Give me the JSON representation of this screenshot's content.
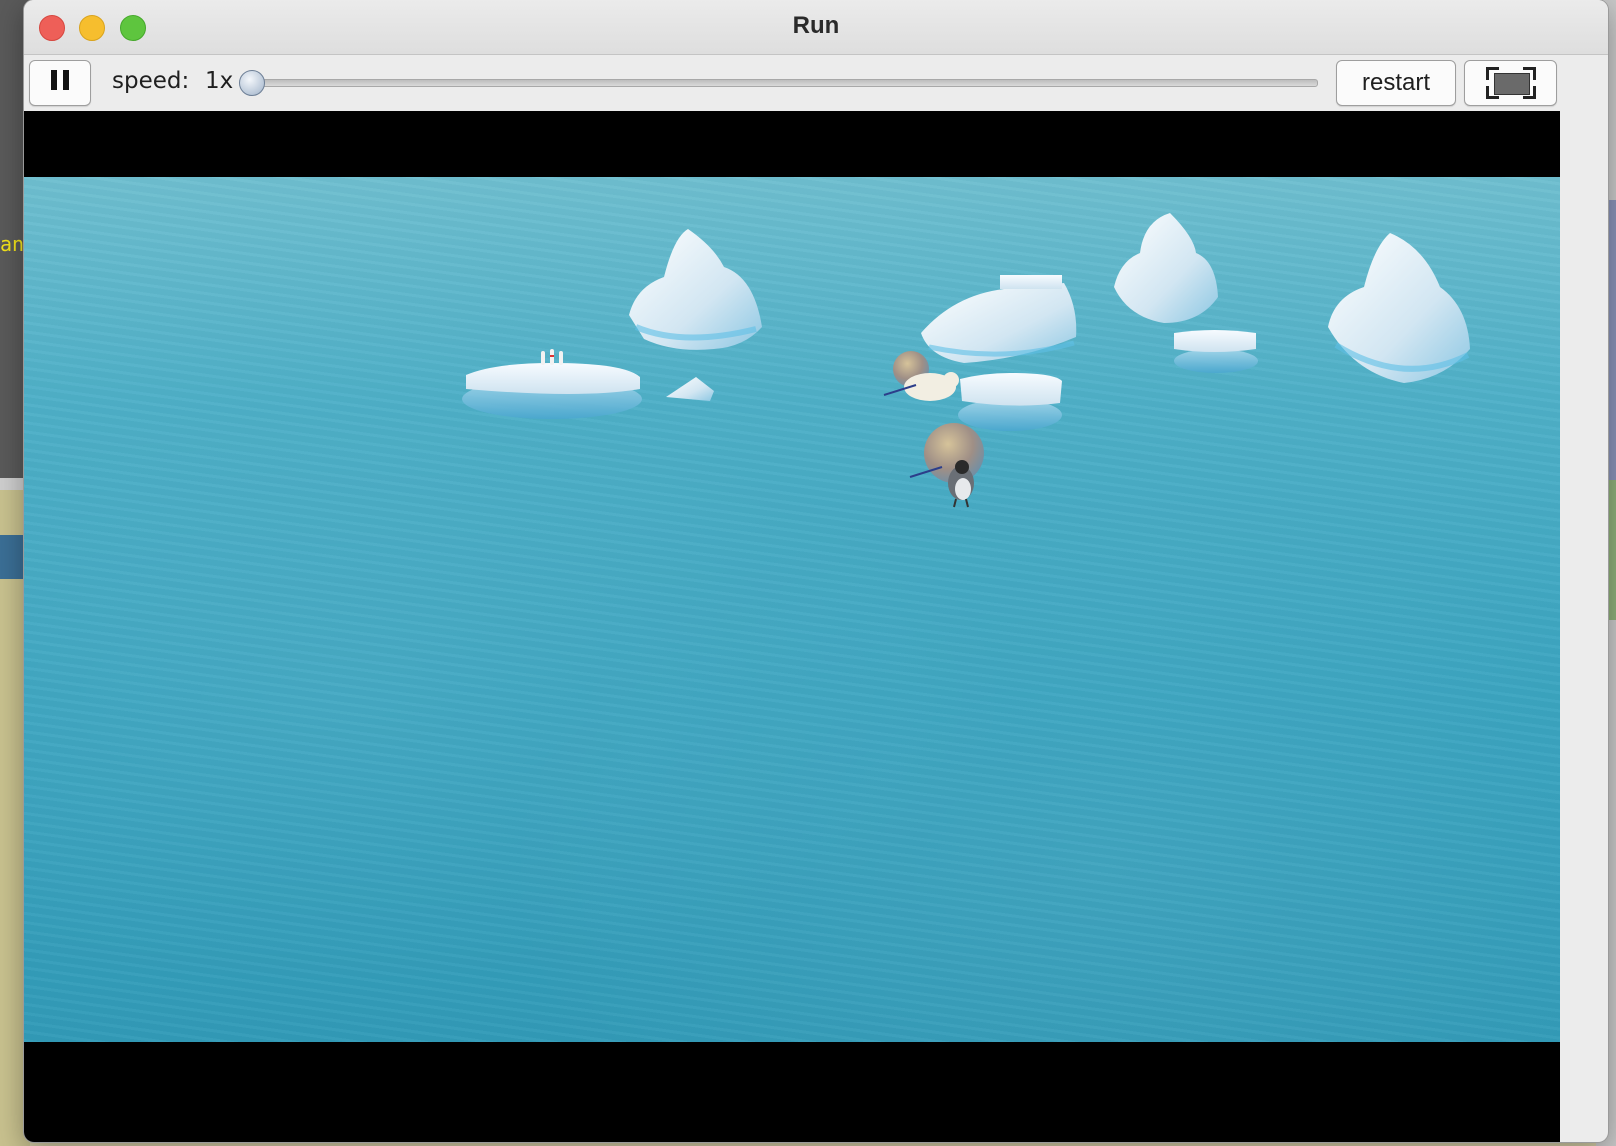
{
  "window": {
    "title": "Run"
  },
  "toolbar": {
    "speed_label": "speed:",
    "speed_value": "1x",
    "speed_slider_fraction": 0.0,
    "restart_label": "restart"
  },
  "background": {
    "left_text": "an"
  },
  "colors": {
    "close": "#ee5f58",
    "minimize": "#f6be2e",
    "maximize": "#5ec53e",
    "water": "#3aa4c0",
    "letterbox": "#000000"
  },
  "icons": {
    "pause": "pause-icon",
    "fullscreen": "fullscreen-icon"
  }
}
